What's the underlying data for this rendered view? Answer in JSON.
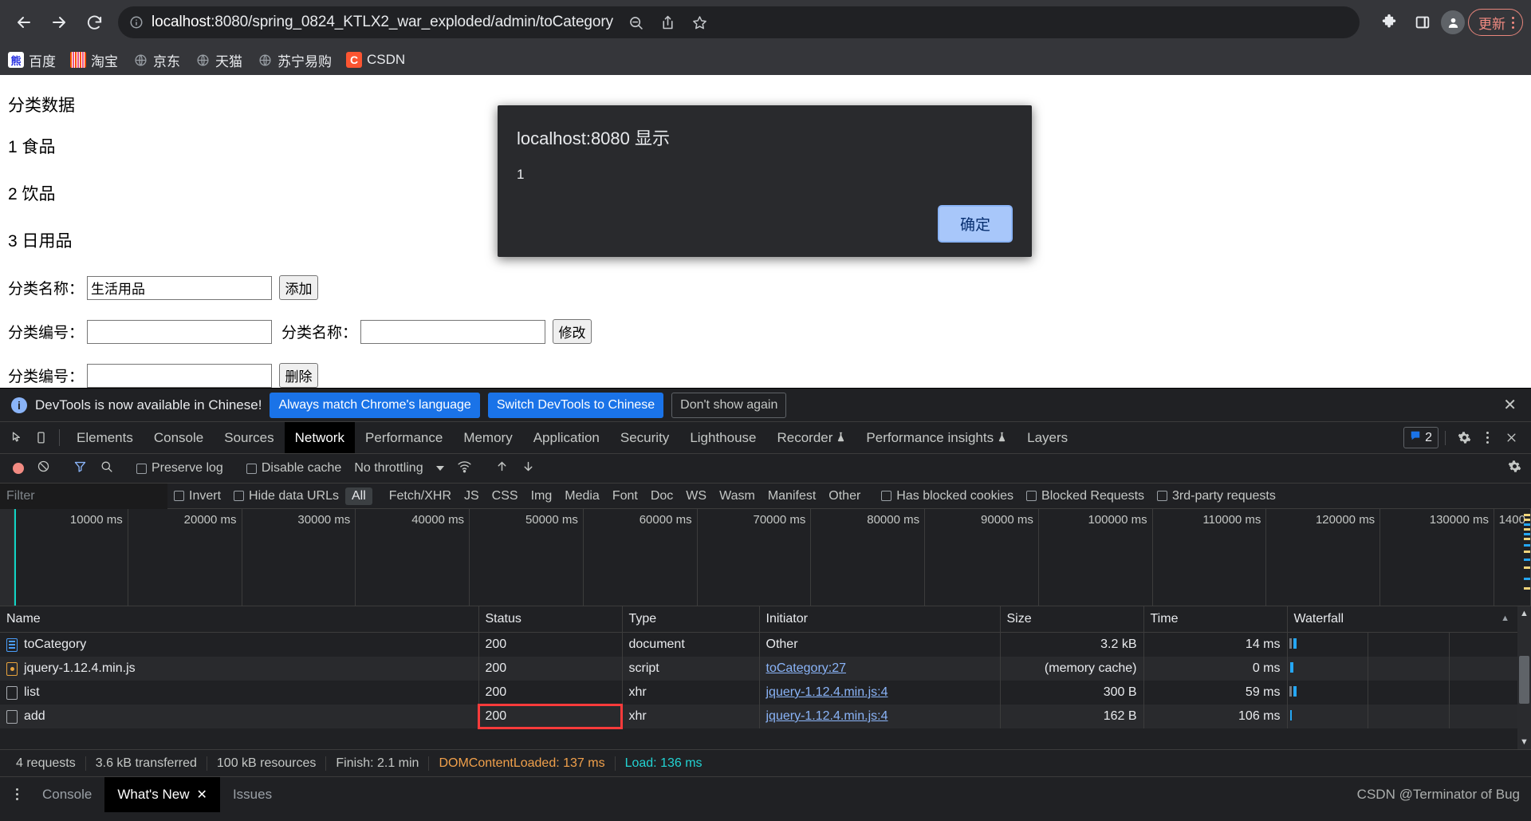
{
  "browser": {
    "url_host": "localhost",
    "url_rest": ":8080/spring_0824_KTLX2_war_exploded/admin/toCategory",
    "back_icon": "back-arrow-icon",
    "forward_icon": "forward-arrow-icon",
    "reload_icon": "reload-icon",
    "info_icon": "site-info-icon",
    "zoom_out_icon": "zoom-out-icon",
    "share_icon": "share-icon",
    "bookmark_icon": "star-icon",
    "extensions_icon": "puzzle-extensions-icon",
    "sidepanel_icon": "side-panel-icon",
    "profile_icon": "profile-avatar-icon",
    "update_label": "更新",
    "menu_icon": "chrome-menu-icon"
  },
  "bookmarks": [
    {
      "label": "百度",
      "icon": "baidu-favicon"
    },
    {
      "label": "淘宝",
      "icon": "taobao-favicon"
    },
    {
      "label": "京东",
      "icon": "globe-favicon"
    },
    {
      "label": "天猫",
      "icon": "globe-favicon"
    },
    {
      "label": "苏宁易购",
      "icon": "globe-favicon"
    },
    {
      "label": "CSDN",
      "icon": "csdn-favicon"
    }
  ],
  "page": {
    "title": "分类数据",
    "categories": [
      {
        "line": "1 食品"
      },
      {
        "line": "2 饮品"
      },
      {
        "line": "3 日用品"
      }
    ],
    "add_form": {
      "label": "分类名称：",
      "value": "生活用品",
      "placeholder": "",
      "button": "添加"
    },
    "update_form": {
      "id_label": "分类编号：",
      "id_value": "",
      "name_label": "分类名称：",
      "name_value": "",
      "button": "修改"
    },
    "delete_form": {
      "id_label": "分类编号：",
      "id_value": "",
      "button": "删除"
    }
  },
  "dialog": {
    "title": "localhost:8080 显示",
    "message": "1",
    "ok_label": "确定"
  },
  "devtools": {
    "banner": {
      "message": "DevTools is now available in Chinese!",
      "primary": "Always match Chrome's language",
      "secondary": "Switch DevTools to Chinese",
      "dismiss": "Don't show again",
      "close_icon": "close-icon"
    },
    "tabs": [
      {
        "label": "Elements",
        "active": false
      },
      {
        "label": "Console",
        "active": false
      },
      {
        "label": "Sources",
        "active": false
      },
      {
        "label": "Network",
        "active": true
      },
      {
        "label": "Performance",
        "active": false
      },
      {
        "label": "Memory",
        "active": false
      },
      {
        "label": "Application",
        "active": false
      },
      {
        "label": "Security",
        "active": false
      },
      {
        "label": "Lighthouse",
        "active": false
      },
      {
        "label": "Recorder",
        "active": false,
        "beaker": true
      },
      {
        "label": "Performance insights",
        "active": false,
        "beaker": true
      },
      {
        "label": "Layers",
        "active": false
      }
    ],
    "issues_count": "2",
    "settings_icon": "gear-icon",
    "more_icon": "more-vertical-icon",
    "close_icon": "close-icon",
    "toolbar": {
      "record_icon": "record-stop-icon",
      "clear_icon": "clear-icon",
      "filter_icon": "filter-icon",
      "search_icon": "search-icon",
      "preserve_log": "Preserve log",
      "disable_cache": "Disable cache",
      "throttling": "No throttling",
      "wifi_icon": "network-conditions-icon",
      "import_icon": "import-har-icon",
      "export_icon": "export-har-icon",
      "settings_icon": "network-settings-icon"
    },
    "filterbar": {
      "placeholder": "Filter",
      "value": "",
      "invert": "Invert",
      "hide_data_urls": "Hide data URLs",
      "types": [
        "All",
        "Fetch/XHR",
        "JS",
        "CSS",
        "Img",
        "Media",
        "Font",
        "Doc",
        "WS",
        "Wasm",
        "Manifest",
        "Other"
      ],
      "selected_type": "All",
      "has_blocked_cookies": "Has blocked cookies",
      "blocked_requests": "Blocked Requests",
      "third_party": "3rd-party requests"
    },
    "timeline_ticks": [
      "10000 ms",
      "20000 ms",
      "30000 ms",
      "40000 ms",
      "50000 ms",
      "60000 ms",
      "70000 ms",
      "80000 ms",
      "90000 ms",
      "100000 ms",
      "110000 ms",
      "120000 ms",
      "130000 ms",
      "1400"
    ],
    "table": {
      "columns": [
        "Name",
        "Status",
        "Type",
        "Initiator",
        "Size",
        "Time",
        "Waterfall"
      ],
      "rows": [
        {
          "name": "toCategory",
          "icon": "document-icon",
          "status": "200",
          "type": "document",
          "initiator": "Other",
          "initiator_link": false,
          "size": "3.2 kB",
          "time": "14 ms",
          "status_dim": false,
          "size_dim": false,
          "highlight_status": false
        },
        {
          "name": "jquery-1.12.4.min.js",
          "icon": "script-icon",
          "status": "200",
          "type": "script",
          "initiator": "toCategory:27",
          "initiator_link": true,
          "size": "(memory cache)",
          "time": "0 ms",
          "status_dim": true,
          "size_dim": true,
          "highlight_status": false
        },
        {
          "name": "list",
          "icon": "xhr-icon",
          "status": "200",
          "type": "xhr",
          "initiator": "jquery-1.12.4.min.js:4",
          "initiator_link": true,
          "size": "300 B",
          "time": "59 ms",
          "status_dim": false,
          "size_dim": false,
          "highlight_status": false
        },
        {
          "name": "add",
          "icon": "xhr-icon",
          "status": "200",
          "type": "xhr",
          "initiator": "jquery-1.12.4.min.js:4",
          "initiator_link": true,
          "size": "162 B",
          "time": "106 ms",
          "status_dim": false,
          "size_dim": false,
          "highlight_status": true
        }
      ]
    },
    "summary": {
      "requests": "4 requests",
      "transferred": "3.6 kB transferred",
      "resources": "100 kB resources",
      "finish": "Finish: 2.1 min",
      "dcl": "DOMContentLoaded: 137 ms",
      "load": "Load: 136 ms"
    },
    "drawer": {
      "more_icon": "more-vertical-icon",
      "tabs": [
        {
          "label": "Console",
          "active": false,
          "closable": false
        },
        {
          "label": "What's New",
          "active": true,
          "closable": true
        },
        {
          "label": "Issues",
          "active": false,
          "closable": false
        }
      ],
      "watermark": "CSDN @Terminator of Bug"
    }
  },
  "colors": {
    "accent_blue": "#1a73e8",
    "link_blue": "#8ab4f8",
    "waterfall_blue": "#25a7f5",
    "dcl_orange": "#f0a04b",
    "load_cyan": "#22d3d3",
    "highlight_red": "#fb3b3b",
    "update_pink": "#f28b82"
  }
}
